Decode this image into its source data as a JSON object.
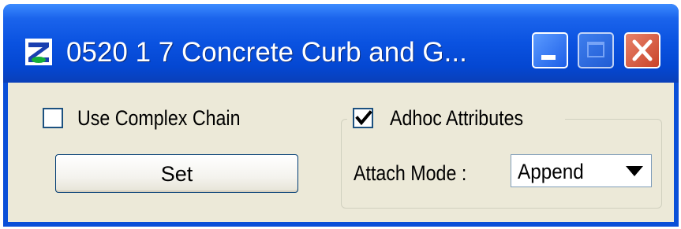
{
  "window": {
    "title": "0520  1  7 Concrete Curb and G...",
    "colors": {
      "titlebar": "#0a52e0",
      "client": "#ece9d8",
      "close_button": "#c9432a"
    }
  },
  "titlebar_buttons": {
    "minimize_icon": "minimize-icon",
    "maximize_icon": "maximize-icon",
    "close_icon": "close-icon"
  },
  "left_panel": {
    "use_complex_chain": {
      "label": "Use Complex Chain",
      "checked": false
    },
    "set_button_label": "Set"
  },
  "right_panel": {
    "adhoc_attributes": {
      "label": "Adhoc Attributes",
      "checked": true
    },
    "attach_mode": {
      "label": "Attach Mode :",
      "value": "Append"
    }
  }
}
